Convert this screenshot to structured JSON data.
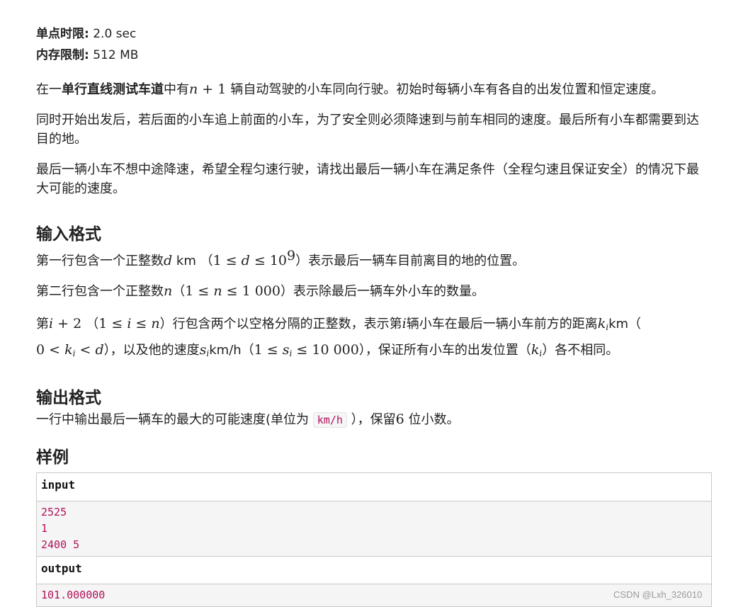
{
  "limits": {
    "time_label": "单点时限:",
    "time_value": "2.0 sec",
    "mem_label": "内存限制:",
    "mem_value": "512 MB"
  },
  "desc": {
    "p1_a": "在一",
    "p1_bold": "单行直线测试车道",
    "p1_b": "中有",
    "p1_math_n": "n",
    "p1_math_plus": " + 1 ",
    "p1_c": "辆自动驾驶的小车同向行驶。初始时每辆小车有各自的出发位置和恒定速度。",
    "p2": "同时开始出发后，若后面的小车追上前面的小车，为了安全则必须降速到与前车相同的速度。最后所有小车都需要到达目的地。",
    "p3": "最后一辆小车不想中途降速，希望全程匀速行驶，请找出最后一辆小车在满足条件（全程匀速且保证安全）的情况下最大可能的速度。"
  },
  "input_format": {
    "heading": "输入格式",
    "l1_a": "第一行包含一个正整数",
    "l1_var": "d",
    "l1_unit": " km （",
    "l1_math_a": "1 ≤ ",
    "l1_math_var": "d",
    "l1_math_b": " ≤ 10",
    "l1_math_exp": "9",
    "l1_b": "）表示最后一辆车目前离目的地的位置。",
    "l2_a": "第二行包含一个正整数",
    "l2_var": "n",
    "l2_b": "（",
    "l2_math_a": "1 ≤ ",
    "l2_math_var": "n",
    "l2_math_b": " ≤ 1 000",
    "l2_c": "）表示除最后一辆车外小车的数量。",
    "l3_a": "第",
    "l3_var_i": "i",
    "l3_math_plus": " + 2 ",
    "l3_b": "（",
    "l3_math_a": "1 ≤ ",
    "l3_math_i": "i",
    "l3_math_b": " ≤ ",
    "l3_math_n": "n",
    "l3_c": "）行包含两个以空格分隔的正整数，表示第",
    "l3_var_i2": "i",
    "l3_d": "辆小车在最后一辆小车前方的距离",
    "l3_var_k": "k",
    "l3_sub_i": "i",
    "l3_e": "km（",
    "l3_m2_a": "0 < ",
    "l3_m2_k": "k",
    "l3_m2_sub": "i",
    "l3_m2_b": " < ",
    "l3_m2_d": "d",
    "l3_f": "），以及他的速度",
    "l3_var_s": "s",
    "l3_sub_s": "i",
    "l3_g": "km/h（",
    "l3_m3_a": "1 ≤ ",
    "l3_m3_s": "s",
    "l3_m3_sub": "i",
    "l3_m3_b": " ≤ 10 000",
    "l3_h": "），保证所有小车的出发位置（",
    "l3_m4_k": "k",
    "l3_m4_sub": "i",
    "l3_i": "）各不相同。"
  },
  "output_format": {
    "heading": "输出格式",
    "l1_a": "一行中输出最后一辆车的最大的可能速度(单位为",
    "l1_code": "km/h",
    "l1_b": "），保留",
    "l1_num": "6",
    "l1_c": "位小数。"
  },
  "example": {
    "heading": "样例",
    "input_label": "input",
    "input_lines": [
      "2525",
      "1",
      "2400 5"
    ],
    "output_label": "output",
    "output_lines": [
      "101.000000"
    ]
  },
  "watermark": "CSDN @Lxh_326010"
}
